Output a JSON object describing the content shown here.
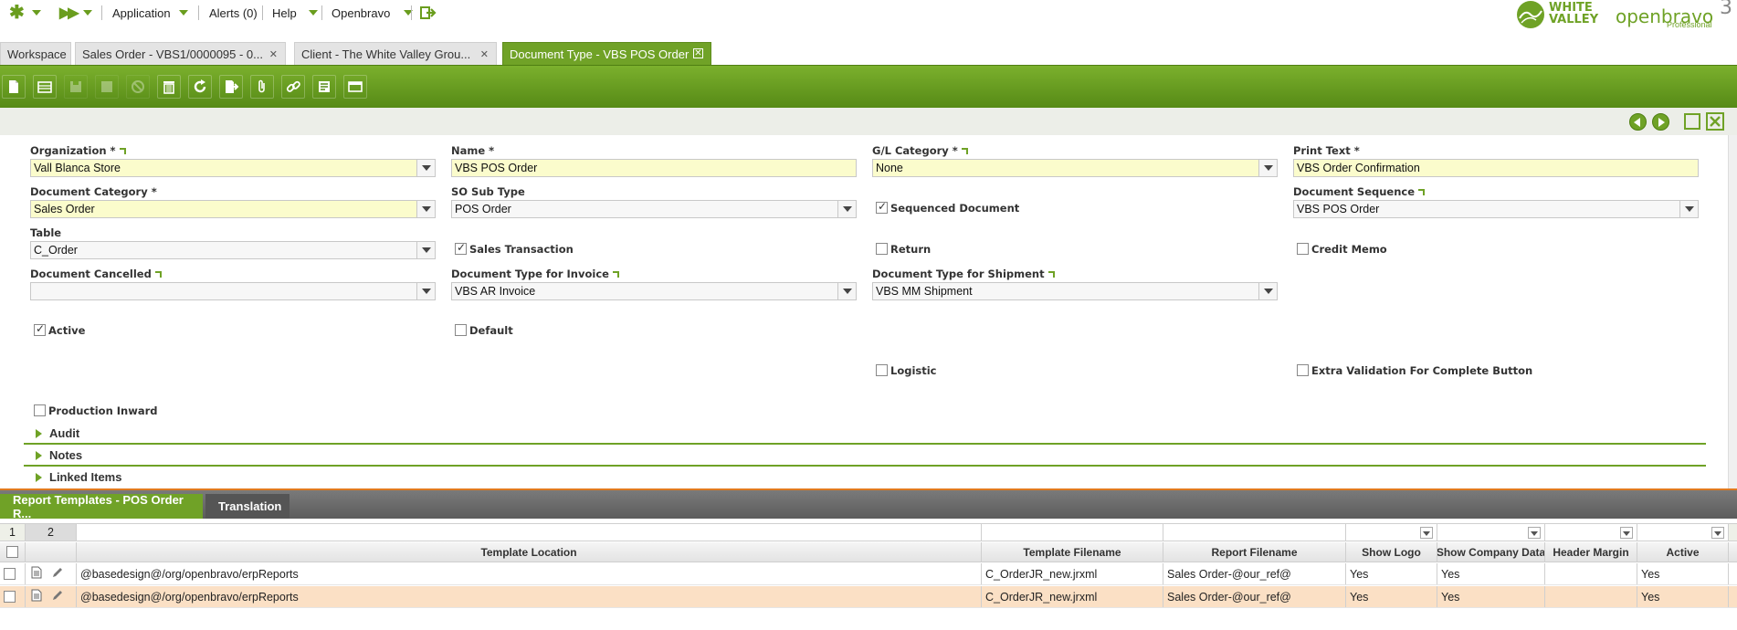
{
  "menu": {
    "application": "Application",
    "alerts": "Alerts (0)",
    "help": "Help",
    "openbravo": "Openbravo"
  },
  "logos": {
    "white_valley": "WHITE VALLEY",
    "openbravo": "openbravo",
    "openbravo_version": "3",
    "openbravo_edition": "Professional"
  },
  "tabs": [
    {
      "label": "Workspace"
    },
    {
      "label": "Sales Order - VBS1/0000095 - 0..."
    },
    {
      "label": "Client - The White Valley Grou..."
    },
    {
      "label": "Document Type - VBS POS Order"
    }
  ],
  "toolbar": {
    "icons": [
      "new-document-icon",
      "new-row-icon",
      "save-icon",
      "save-close-icon",
      "undo-icon",
      "delete-icon",
      "refresh-icon",
      "export-icon",
      "attach-icon",
      "link-icon",
      "audit-icon",
      "grid-view-icon"
    ]
  },
  "form": {
    "organization": {
      "label": "Organization *",
      "value": "Vall Blanca Store"
    },
    "name": {
      "label": "Name *",
      "value": "VBS POS Order"
    },
    "gl_category": {
      "label": "G/L Category *",
      "value": "None"
    },
    "print_text": {
      "label": "Print Text *",
      "value": "VBS Order Confirmation"
    },
    "document_category": {
      "label": "Document Category *",
      "value": "Sales Order"
    },
    "so_sub_type": {
      "label": "SO Sub Type",
      "value": "POS Order"
    },
    "sequenced_document": {
      "label": "Sequenced Document",
      "checked": true
    },
    "document_sequence": {
      "label": "Document Sequence",
      "value": "VBS POS Order"
    },
    "table": {
      "label": "Table",
      "value": "C_Order"
    },
    "sales_transaction": {
      "label": "Sales Transaction",
      "checked": true
    },
    "return": {
      "label": "Return",
      "checked": false
    },
    "credit_memo": {
      "label": "Credit Memo",
      "checked": false
    },
    "document_cancelled": {
      "label": "Document Cancelled",
      "value": ""
    },
    "doc_type_invoice": {
      "label": "Document Type for Invoice",
      "value": "VBS AR Invoice"
    },
    "doc_type_shipment": {
      "label": "Document Type for Shipment",
      "value": "VBS MM Shipment"
    },
    "active": {
      "label": "Active",
      "checked": true
    },
    "default": {
      "label": "Default",
      "checked": false
    },
    "logistic": {
      "label": "Logistic",
      "checked": false
    },
    "extra_validation": {
      "label": "Extra Validation For Complete Button",
      "checked": false
    },
    "production_inward": {
      "label": "Production Inward",
      "checked": false
    }
  },
  "sections": [
    "Audit",
    "Notes",
    "Linked Items"
  ],
  "subtabs": [
    {
      "label": "Report Templates - POS Order R..."
    },
    {
      "label": "Translation"
    }
  ],
  "grid": {
    "row_numbers": [
      "1",
      "2"
    ],
    "columns": [
      "Template Location",
      "Template Filename",
      "Report Filename",
      "Show Logo",
      "Show Company Data",
      "Header Margin",
      "Active"
    ],
    "rows": [
      {
        "template_location": "@basedesign@/org/openbravo/erpReports",
        "template_filename": "C_OrderJR_new.jrxml",
        "report_filename": "Sales Order-@our_ref@",
        "show_logo": "Yes",
        "show_company_data": "Yes",
        "header_margin": "",
        "active": "Yes"
      },
      {
        "template_location": "@basedesign@/org/openbravo/erpReports",
        "template_filename": "C_OrderJR_new.jrxml",
        "report_filename": "Sales Order-@our_ref@",
        "show_logo": "Yes",
        "show_company_data": "Yes",
        "header_margin": "",
        "active": "Yes"
      }
    ]
  },
  "colors": {
    "brand_green": "#70a227",
    "required_field": "#fbfccc",
    "selected_row": "#fbe0c5"
  }
}
